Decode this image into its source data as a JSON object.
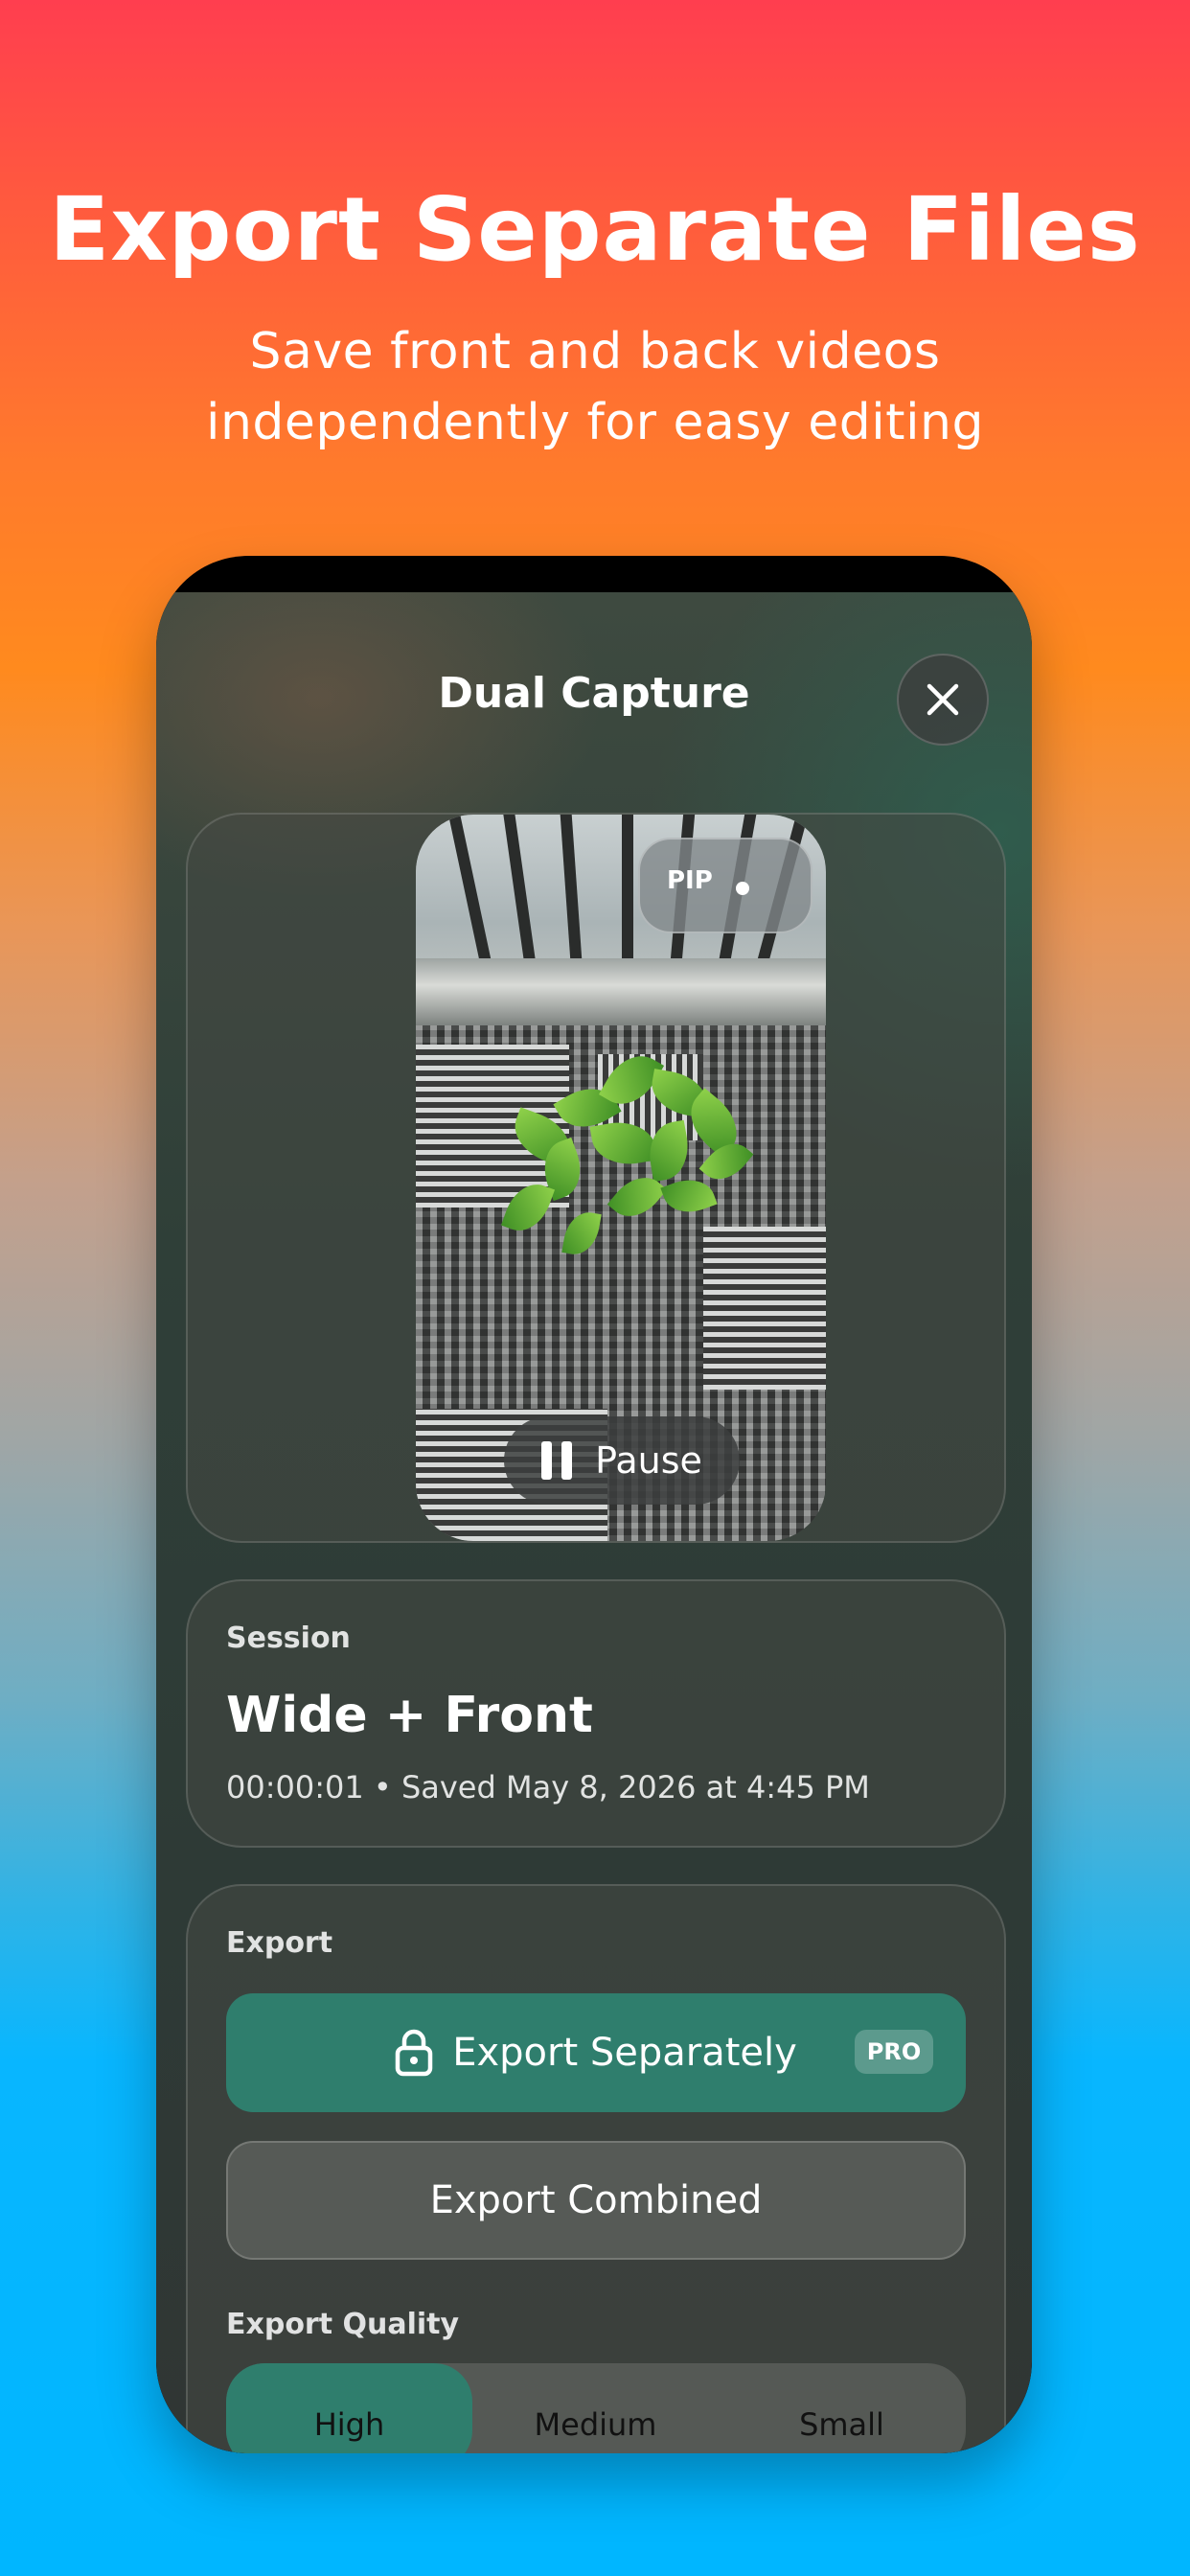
{
  "marketing": {
    "headline": "Export Separate Files",
    "subline": "Save front and back videos independently for easy editing"
  },
  "app": {
    "title": "Dual Capture",
    "close_icon": "close-icon",
    "preview": {
      "pip_label": "PIP",
      "pause_label": "Pause",
      "pause_icon": "pause-icon"
    },
    "session": {
      "label": "Session",
      "name": "Wide + Front",
      "meta": "00:00:01 • Saved May 8, 2026 at 4:45 PM"
    },
    "export": {
      "label": "Export",
      "separately_label": "Export Separately",
      "lock_icon": "lock-icon",
      "pro_badge": "PRO",
      "combined_label": "Export Combined",
      "quality_label": "Export Quality",
      "quality_options": [
        "High",
        "Medium",
        "Small"
      ],
      "quality_selected": "High"
    }
  },
  "colors": {
    "accent": "#2f7e6d",
    "background_top": "#ff3e4f",
    "background_bottom": "#00b6ff"
  }
}
